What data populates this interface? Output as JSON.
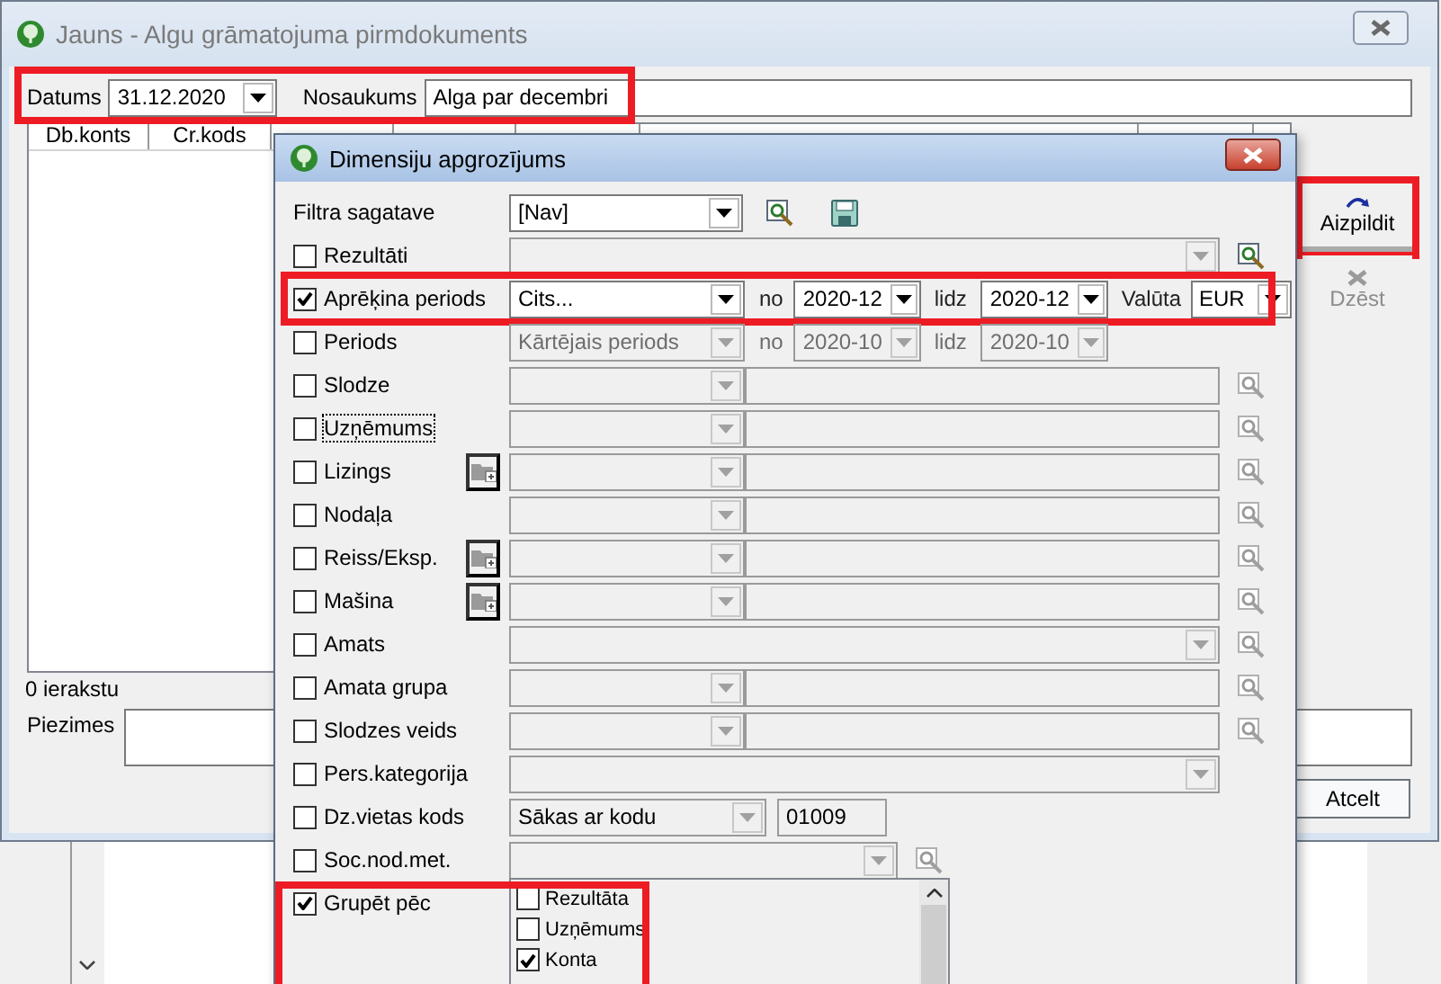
{
  "main_window": {
    "title": "Jauns - Algu grāmatojuma pirmdokuments",
    "date_label": "Datums",
    "date": "31.12.2020",
    "name_label": "Nosaukums",
    "name": "Alga par decembri",
    "header_highlighted": true,
    "table": {
      "columns": [
        "Db.konts",
        "Cr.kods"
      ]
    },
    "buttons": [
      {
        "label": "Aizpildit",
        "disabled": false,
        "highlighted": true
      },
      {
        "label": "Dzēst",
        "disabled": true
      }
    ],
    "record_count": "0 ierakstu",
    "notes_label": "Piezimes",
    "cancel": "Atcelt"
  },
  "dialog": {
    "title": "Dimensiju apgrozījums",
    "rows": [
      {
        "kind": "template",
        "label": "Filtra sagatave",
        "value": "[Nav]"
      },
      {
        "kind": "full",
        "label": "Rezultāti",
        "checked": false,
        "search": true
      },
      {
        "kind": "period",
        "label": "Aprēķina periods",
        "checked": true,
        "disabled": false,
        "value": "Cits...",
        "from_label": "no",
        "from": "2020-12",
        "to_label": "lidz",
        "to": "2020-12",
        "currency_label": "Valūta",
        "currency": "EUR",
        "highlighted": true
      },
      {
        "kind": "period",
        "label": "Periods",
        "checked": false,
        "disabled": true,
        "value": "Kārtējais periods",
        "from_label": "no",
        "from": "2020-10",
        "to_label": "lidz",
        "to": "2020-10"
      },
      {
        "kind": "pair",
        "label": "Slodze",
        "checked": false,
        "search": true
      },
      {
        "kind": "pair",
        "label": "Uzņēmums",
        "checked": false,
        "focused": true,
        "search": true
      },
      {
        "kind": "pair",
        "label": "Lizings",
        "checked": false,
        "folder": true,
        "search": true
      },
      {
        "kind": "pair",
        "label": "Nodaļa",
        "checked": false,
        "search": true
      },
      {
        "kind": "pair",
        "label": "Reiss/Eksp.",
        "checked": false,
        "folder": true,
        "search": true
      },
      {
        "kind": "pair",
        "label": "Mašina",
        "checked": false,
        "folder": true,
        "search": true
      },
      {
        "kind": "full",
        "label": "Amats",
        "checked": false,
        "search": true
      },
      {
        "kind": "pair",
        "label": "Amata grupa",
        "checked": false,
        "search": true
      },
      {
        "kind": "pair",
        "label": "Slodzes veids",
        "checked": false,
        "search": true
      },
      {
        "kind": "full",
        "label": "Pers.kategorija",
        "checked": false,
        "search": false
      },
      {
        "kind": "code",
        "label": "Dz.vietas kods",
        "checked": false,
        "value": "Sākas ar kodu",
        "code": "01009"
      },
      {
        "kind": "combo",
        "label": "Soc.nod.met.",
        "checked": false,
        "search": true
      },
      {
        "kind": "group",
        "label": "Grupēt pēc",
        "checked": true,
        "highlighted": true,
        "items": [
          {
            "label": "Rezultāta",
            "checked": false
          },
          {
            "label": "Uzņēmums",
            "checked": false
          },
          {
            "label": "Konta",
            "checked": true
          }
        ]
      }
    ]
  }
}
